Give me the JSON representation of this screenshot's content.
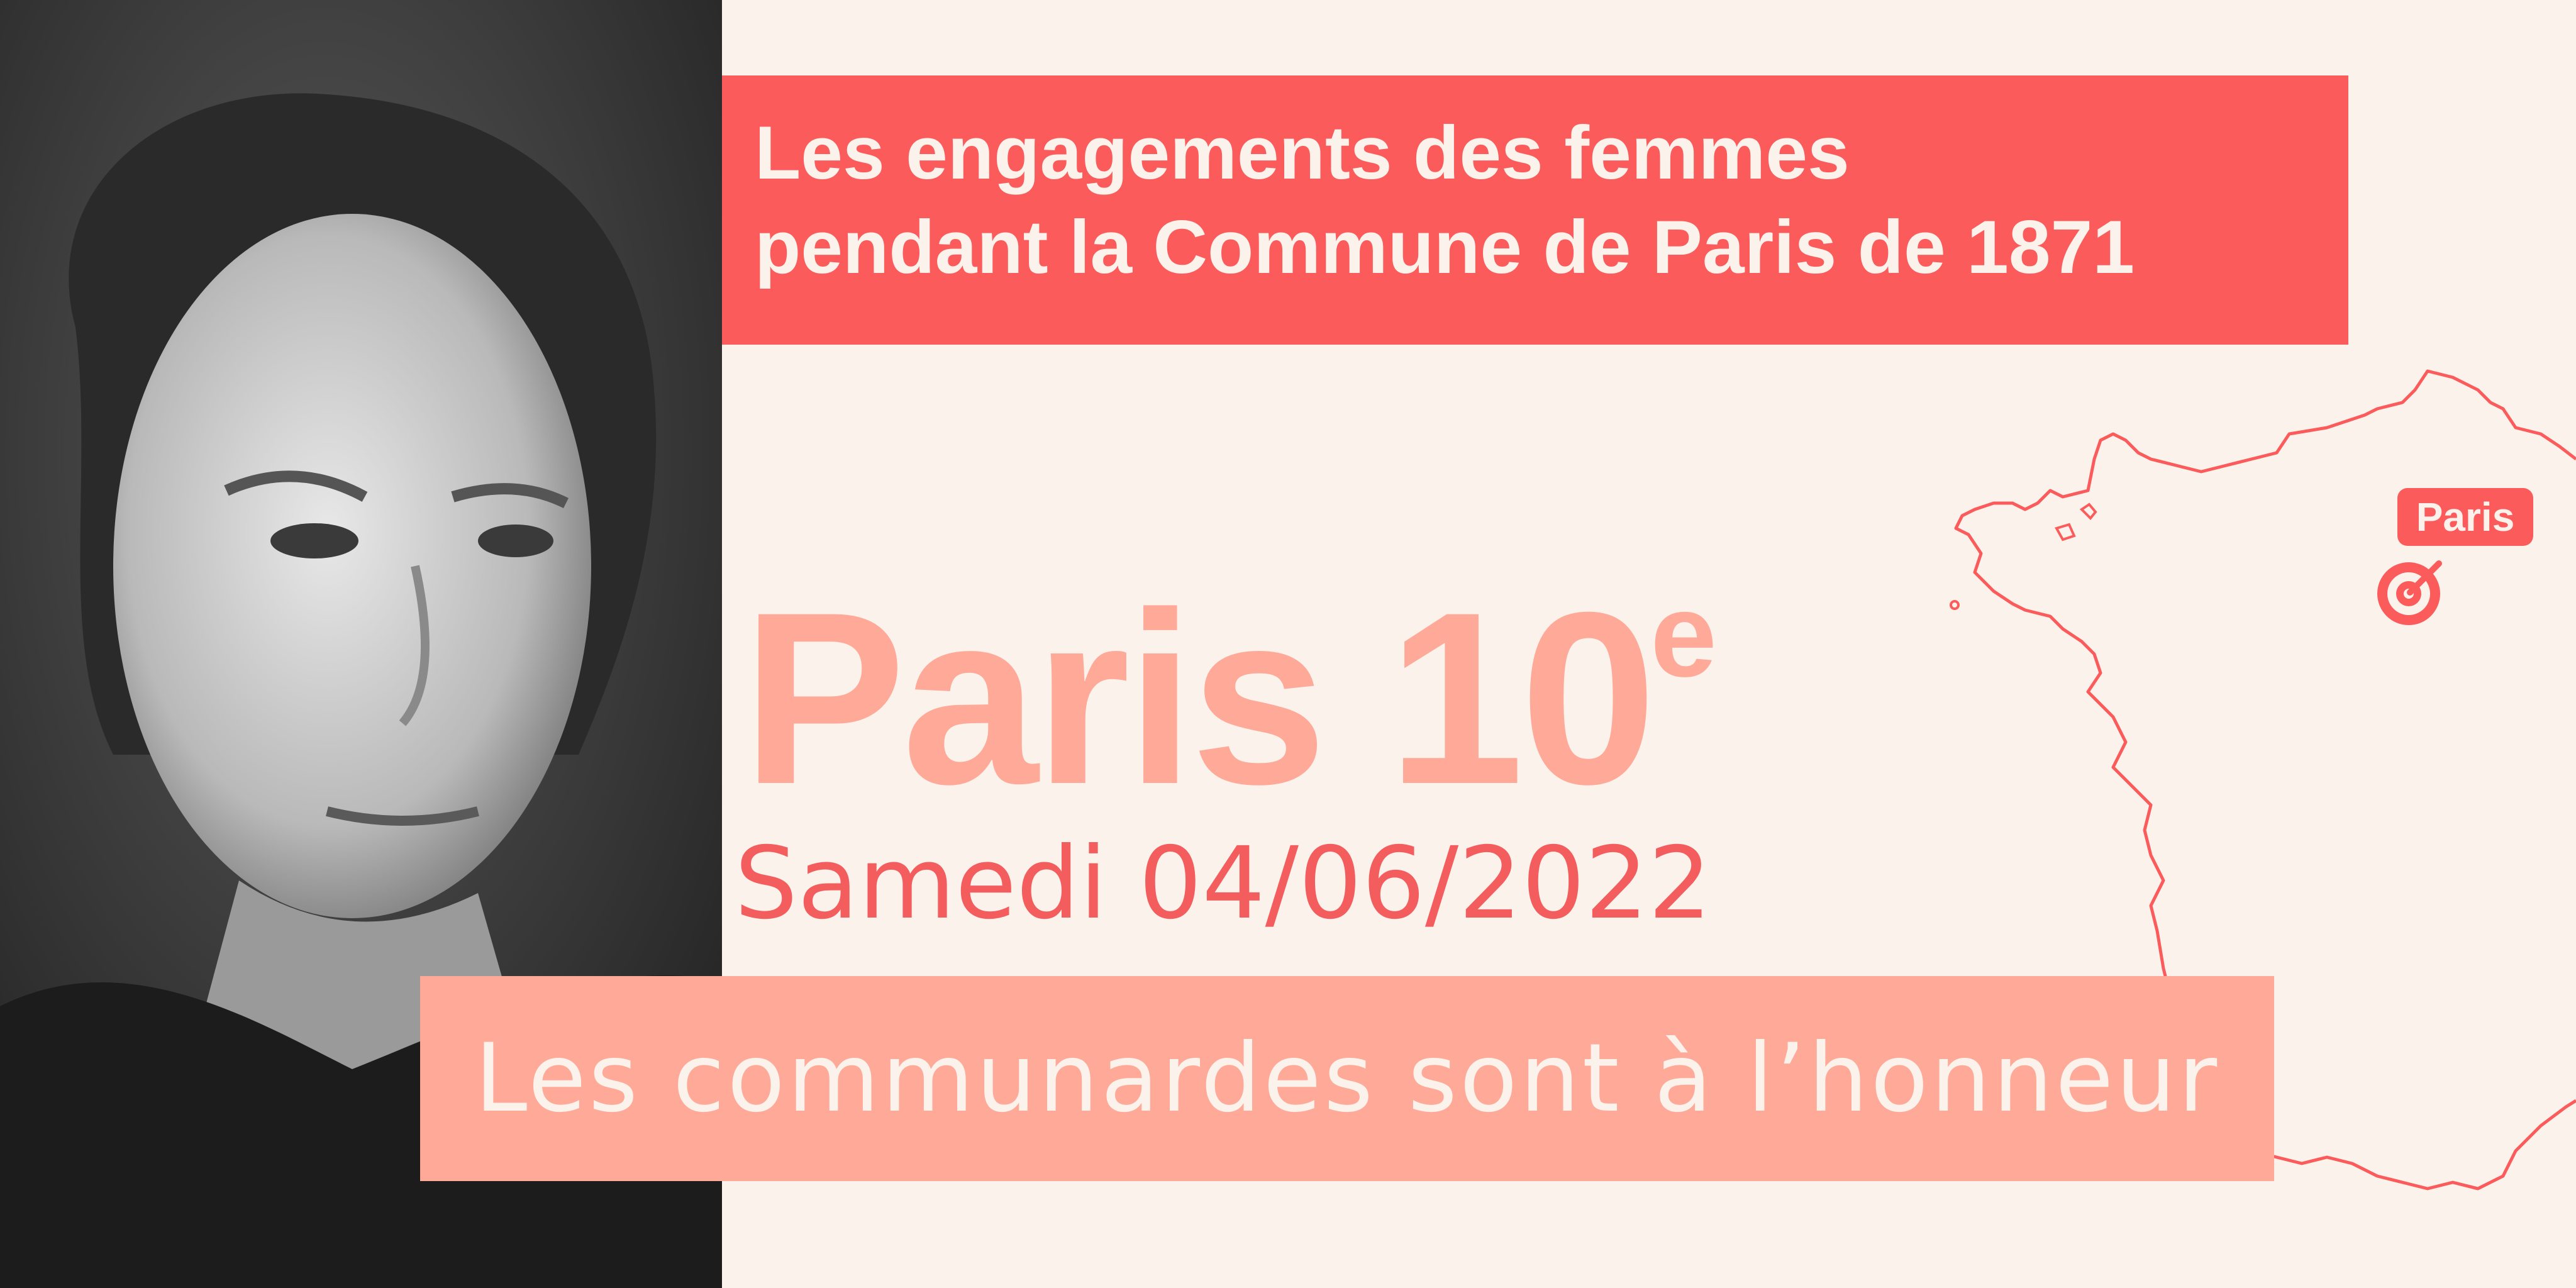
{
  "title": {
    "line1": "Les engagements des femmes",
    "line2": "pendant la Commune de Paris de 1871"
  },
  "location": {
    "city": "Paris 10",
    "suffix": "e"
  },
  "date": "Samedi 04/06/2022",
  "tagline": "Les communardes sont à l’honneur",
  "map": {
    "marker_label": "Paris",
    "marker_icon": "target-icon"
  },
  "colors": {
    "background": "#fbf2ec",
    "accent_red": "#fb5b5b",
    "accent_salmon": "#ffaa98"
  }
}
